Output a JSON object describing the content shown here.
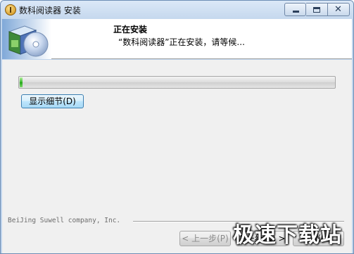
{
  "window": {
    "title": "数科阅读器 安装"
  },
  "header": {
    "title": "正在安装",
    "subtitle": "“数科阅读器”正在安装，请等候..."
  },
  "progress": {
    "fraction": 0.01,
    "accent": "#2ba91f"
  },
  "details_button": {
    "label": "显示细节(D)"
  },
  "footer": {
    "brand": "BeiJing Suwell company, Inc.",
    "back_label": "< 上一步(P)",
    "next_label": "下一步(N) >",
    "cancel_label": "取消(C)"
  },
  "watermark": {
    "text": "极速下载站"
  },
  "icons": {
    "app": "installer-icon",
    "header": "installer-box-cd-icon",
    "minimize": "minimize-icon",
    "maximize": "maximize-icon",
    "close": "close-icon"
  }
}
